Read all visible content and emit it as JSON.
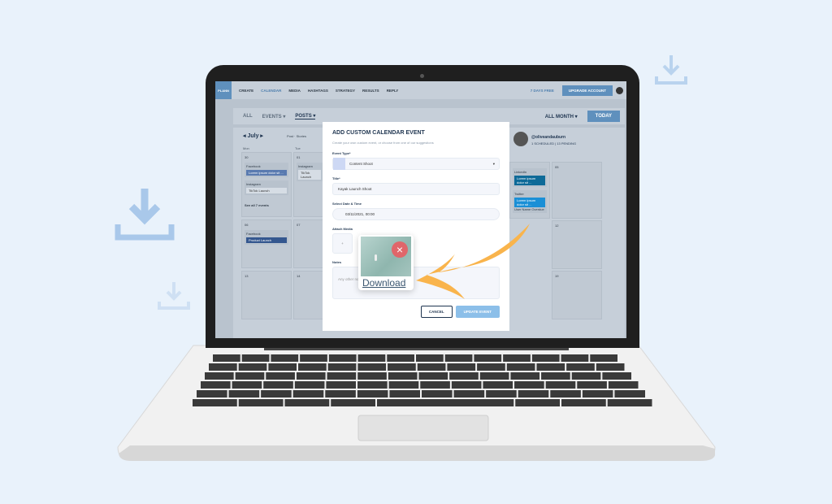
{
  "nav": {
    "logo": "PLANN",
    "items": [
      "CREATE",
      "CALENDAR",
      "MEDIA",
      "HASHTAGS",
      "STRATEGY",
      "RESULTS",
      "REPLY"
    ],
    "active": "CALENDAR",
    "trial": "7 DAYS FREE",
    "upgrade": "UPGRADE ACCOUNT"
  },
  "filter": {
    "all": "ALL",
    "events": "EVENTS ▾",
    "posts": "POSTS ▾",
    "all_month": "ALL MONTH ▾",
    "today": "TODAY"
  },
  "calendar": {
    "month": "July",
    "legend_post": "Post",
    "legend_stories": "Stories",
    "day_mon": "Mon",
    "day_tue": "Tue",
    "profile": {
      "handle": "@oliveandauburn",
      "stats": "1 SCHEDULED | 13 PENDING"
    },
    "cells": [
      "30",
      "06",
      "13",
      "01",
      "07",
      "14",
      "05",
      "12",
      "19"
    ],
    "posts": {
      "fb1": "Facebook",
      "fb1_text": "Lorem ipsum dolor sit ...",
      "ig1": "Instagram",
      "ig1_text": "TikTok Launch",
      "see_all": "See all 7 events",
      "fb2": "Facebook",
      "fb2_text": "Product Launch",
      "ig2": "Instagram",
      "ig2_text": "TikTok Launch",
      "li": "LinkedIn",
      "li_text": "Lorem ipsum dolor sit ...",
      "tw": "Twitter",
      "tw_text": "Lorem ipsum dolor sit ...",
      "user": "User Name",
      "overdue": "Overdue"
    }
  },
  "modal": {
    "title": "ADD CUSTOM CALENDAR EVENT",
    "subtitle": "Create your own custom event, or choose from one of our suggestions",
    "event_type_label": "Event Type*",
    "event_type": "Content Shoot",
    "title_label": "Title*",
    "title_value": "Kayak Launch Shoot",
    "date_label": "Select Date & Time",
    "date_value": "03/11/2021, 00:00",
    "media_label": "Attach Media",
    "add": "+",
    "notes_label": "Notes",
    "notes_placeholder": "Any other notes...",
    "cancel": "CANCEL",
    "update": "UPDATE EVENT"
  },
  "popup": {
    "download": "Download"
  },
  "colors": {
    "background": "#e9f2fb",
    "accent": "#6fa8dc",
    "arrow": "#f9b44c",
    "remove": "#e0666a"
  }
}
